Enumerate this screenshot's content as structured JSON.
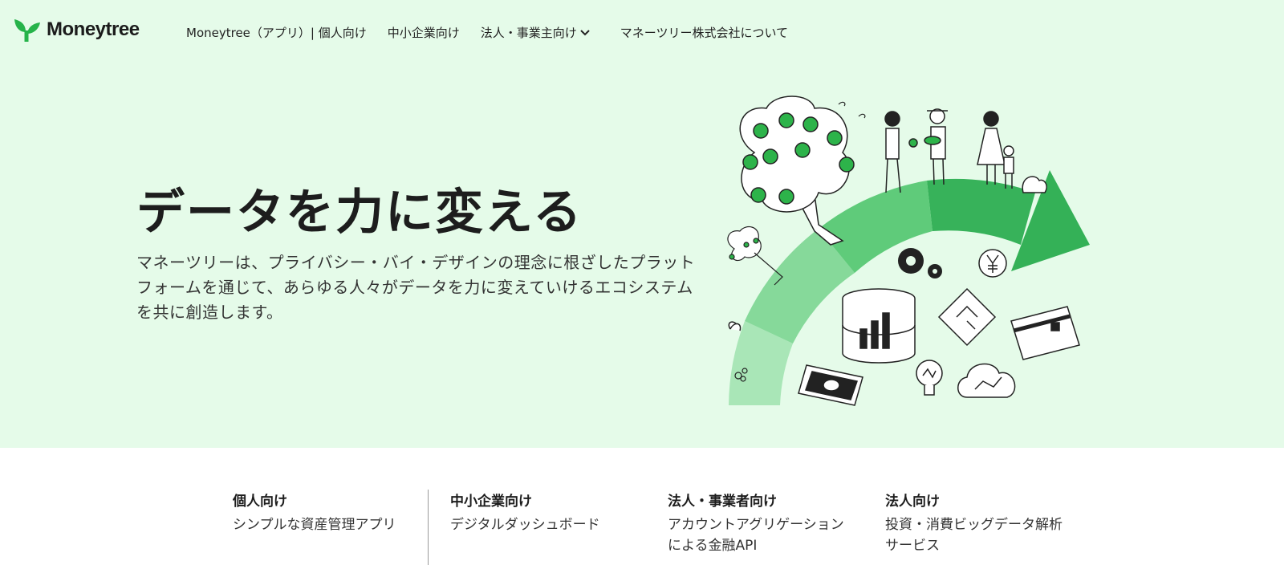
{
  "brand": {
    "name": "Moneytree",
    "logo_color": "#26b34a"
  },
  "nav": {
    "items": [
      {
        "label": "Moneytree（アプリ）| 個人向け"
      },
      {
        "label": "中小企業向け"
      },
      {
        "label": "法人・事業主向け",
        "has_dropdown": true,
        "icon": "chevron-down-icon"
      },
      {
        "label": "マネーツリー株式会社について"
      }
    ]
  },
  "hero": {
    "title": "データを力に変える",
    "description": "マネーツリーは、プライバシー・バイ・デザインの理念に根ざしたプラットフォームを通じて、あらゆる人々がデータを力に変えていけるエコシステムを共に創造します。",
    "background": "#e5fbe9",
    "illustration_icons": [
      "tree-icon",
      "people-icon",
      "arrow-arc-icon",
      "gear-icon",
      "yen-icon",
      "database-chart-icon",
      "maze-icon",
      "credit-card-icon",
      "banknote-icon",
      "lightbulb-icon",
      "cloud-chart-icon",
      "sprout-icon"
    ]
  },
  "categories": [
    {
      "title": "個人向け",
      "subtitle": "シンプルな資産管理アプリ"
    },
    {
      "title": "中小企業向け",
      "subtitle": "デジタルダッシュボード"
    },
    {
      "title": "法人・事業者向け",
      "subtitle": "アカウントアグリゲーションによる金融API"
    },
    {
      "title": "法人向け",
      "subtitle": "投資・消費ビッグデータ解析サービス"
    }
  ],
  "colors": {
    "green_dark": "#2fa94e",
    "green_mid": "#5cc979",
    "green_light": "#9fe0ae",
    "ink": "#1d1d1d"
  }
}
